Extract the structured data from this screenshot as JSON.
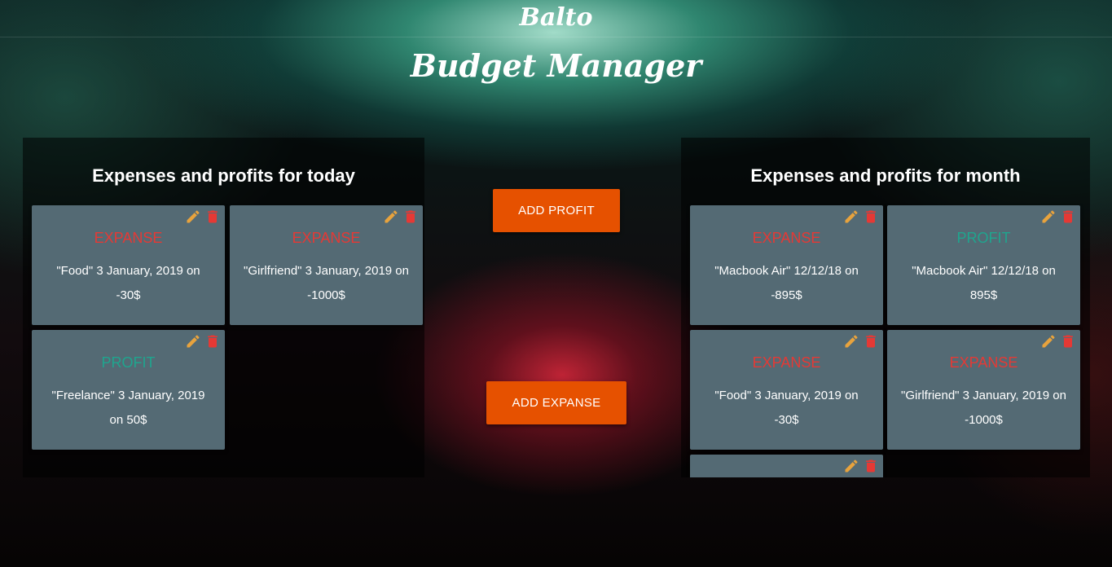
{
  "brand": {
    "name": "Balto",
    "title": "Budget Manager"
  },
  "colors": {
    "expanse": "#e53935",
    "profit": "#1fa58e",
    "card_bg": "#546a74",
    "button_bg": "#e65100",
    "edit_icon": "#e8a33d",
    "delete_icon": "#e53935"
  },
  "actions": {
    "add_profit": "ADD PROFIT",
    "add_expanse": "ADD EXPANSE"
  },
  "today": {
    "title": "Expenses and profits for today",
    "items": [
      {
        "type": "EXPANSE",
        "kind": "expanse",
        "desc": "\"Food\" 3 January, 2019 on -30$"
      },
      {
        "type": "EXPANSE",
        "kind": "expanse",
        "desc": "\"Girlfriend\" 3 January, 2019 on -1000$"
      },
      {
        "type": "PROFIT",
        "kind": "profit",
        "desc": "\"Freelance\" 3 January, 2019 on 50$"
      }
    ]
  },
  "month": {
    "title": "Expenses and profits for month",
    "items": [
      {
        "type": "EXPANSE",
        "kind": "expanse",
        "desc": "\"Macbook Air\" 12/12/18 on -895$"
      },
      {
        "type": "PROFIT",
        "kind": "profit",
        "desc": "\"Macbook Air\" 12/12/18 on 895$"
      },
      {
        "type": "EXPANSE",
        "kind": "expanse",
        "desc": "\"Food\" 3 January, 2019 on -30$"
      },
      {
        "type": "EXPANSE",
        "kind": "expanse",
        "desc": "\"Girlfriend\" 3 January, 2019 on -1000$"
      }
    ]
  },
  "icons": {
    "edit": "pencil-icon",
    "delete": "trash-icon"
  }
}
